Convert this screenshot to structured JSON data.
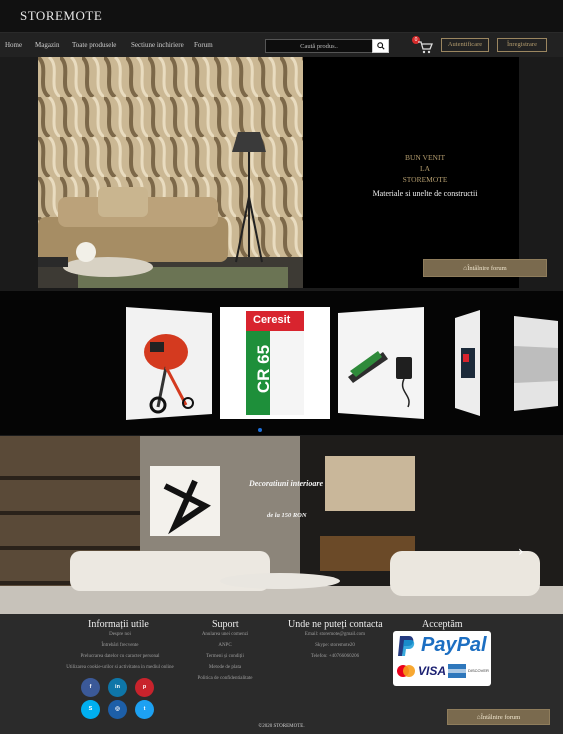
{
  "brand": "STOREMOTE",
  "nav": {
    "items": [
      "Home",
      "Magazin",
      "Toate produsele",
      "Sectiune inchiriere",
      "Forum"
    ]
  },
  "search": {
    "placeholder": "Caută produs.."
  },
  "cart": {
    "count": "0"
  },
  "auth": {
    "login_label": "Autentificare",
    "register_label": "Înregistrare"
  },
  "hero": {
    "welcome_lines": [
      "BUN VENIT",
      "LA",
      "STOREMOTE"
    ],
    "tagline": "Materiale si unelte de constructii",
    "forum_button": "Întâlnire forum"
  },
  "carousel": {
    "items": [
      "concrete-mixer",
      "ceresit-cr65",
      "pruning-shears",
      "power-tool-box",
      "stone-tile"
    ],
    "product_text": {
      "ceresit_brand": "Ceresit",
      "ceresit_code": "CR 65"
    }
  },
  "banner": {
    "title": "Decoratiuni interioare",
    "subtitle": "de la 150 RON"
  },
  "footer": {
    "info": {
      "title": "Informații utile",
      "links": [
        "Despre noi",
        "Întrebări frecvente",
        "Prelucrarea datelor cu caracter personal",
        "Utilizarea cookie-urilor si activitatea in mediul online"
      ]
    },
    "support": {
      "title": "Suport",
      "links": [
        "Anularea unei comenzi",
        "ANPC",
        "Termeni și condiții",
        "Metode de plata",
        "Politica de confidentialitate"
      ]
    },
    "contact": {
      "title": "Unde ne puteți contacta",
      "lines": [
        "Email: storemote@gmail.com",
        "Skype: storemote20",
        "Telefon: +40766060206"
      ]
    },
    "accept": {
      "title": "Acceptăm",
      "paypal": "PayPal",
      "cards": [
        "VISA",
        "DISCOVER"
      ]
    },
    "social": [
      {
        "icon": "facebook-icon",
        "glyph": "f",
        "color": "#3b5998"
      },
      {
        "icon": "linkedin-icon",
        "glyph": "in",
        "color": "#0e76a8"
      },
      {
        "icon": "pinterest-icon",
        "glyph": "p",
        "color": "#c8232c"
      },
      {
        "icon": "skype-icon",
        "glyph": "S",
        "color": "#00aff0"
      },
      {
        "icon": "instagram-icon",
        "glyph": "◎",
        "color": "#1d5fa8"
      },
      {
        "icon": "twitter-icon",
        "glyph": "t",
        "color": "#1da1f2"
      }
    ],
    "forum_button": "Întâlnire forum",
    "copyright": "©2020 STOREMOTE."
  }
}
